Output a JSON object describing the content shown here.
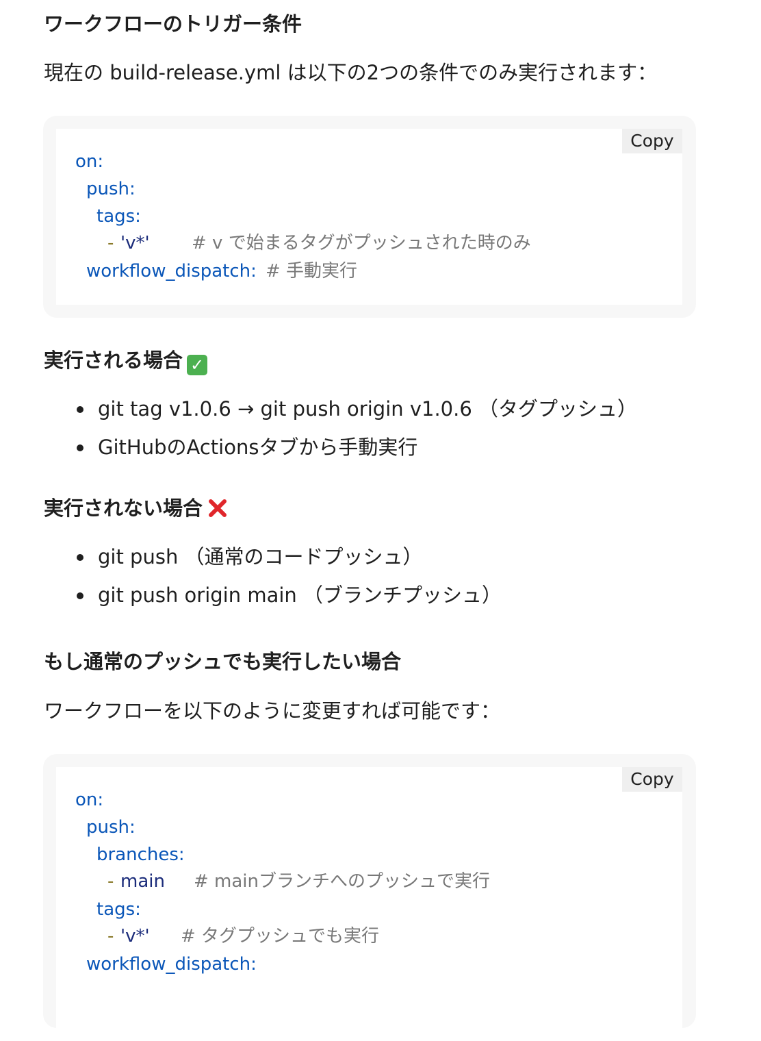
{
  "sections": {
    "trigger_title": "ワークフローのトリガー条件",
    "trigger_intro": "現在の build-release.yml は以下の2つの条件でのみ実行されます：",
    "runs_title": "実行される場合",
    "runs_icon": "check-mark-icon",
    "runs_items": [
      "git tag v1.0.6 → git push origin v1.0.6 （タグプッシュ）",
      "GitHubのActionsタブから手動実行"
    ],
    "notrun_title": "実行されない場合",
    "notrun_icon": "cross-mark-icon",
    "notrun_items": [
      "git push （通常のコードプッシュ）",
      "git push origin main （ブランチプッシュ）"
    ],
    "change_title": "もし通常のプッシュでも実行したい場合",
    "change_intro": "ワークフローを以下のように変更すれば可能です："
  },
  "code_blocks": [
    {
      "copy_label": "Copy",
      "lines": [
        {
          "key": "on:"
        },
        {
          "key": "push:"
        },
        {
          "key": "tags:"
        },
        {
          "dash": "-",
          "value": "'v*'",
          "comment": "# v で始まるタグがプッシュされた時のみ"
        },
        {
          "key": "workflow_dispatch:",
          "comment": "# 手動実行"
        }
      ]
    },
    {
      "copy_label": "Copy",
      "lines": [
        {
          "key": "on:"
        },
        {
          "key": "push:"
        },
        {
          "key": "branches:"
        },
        {
          "dash": "-",
          "value": "main",
          "comment": "# mainブランチへのプッシュで実行"
        },
        {
          "key": "tags:"
        },
        {
          "dash": "-",
          "value": "'v*'",
          "comment": "# タグプッシュでも実行"
        },
        {
          "key": "workflow_dispatch:"
        }
      ]
    }
  ],
  "colors": {
    "yaml_key": "#0a56b8",
    "yaml_string": "#1a2b7a",
    "yaml_dash": "#8a7a2a",
    "yaml_comment": "#787878",
    "check_green": "#4cb050",
    "cross_red": "#e0262b"
  }
}
